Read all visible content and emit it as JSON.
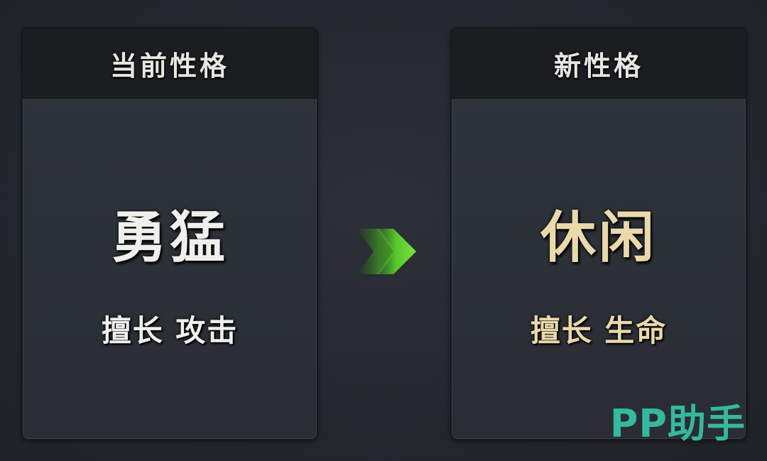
{
  "current": {
    "title": "当前性格",
    "trait": "勇猛",
    "description": "擅长 攻击"
  },
  "new": {
    "title": "新性格",
    "trait": "休闲",
    "description": "擅长 生命"
  },
  "arrow_icon": "double-chevron-right-icon",
  "watermark": "PP助手",
  "colors": {
    "current_text": "#efefec",
    "new_text": "#ead9aa",
    "arrow_green": "#5fcf2e",
    "watermark": "#35c1a4"
  }
}
